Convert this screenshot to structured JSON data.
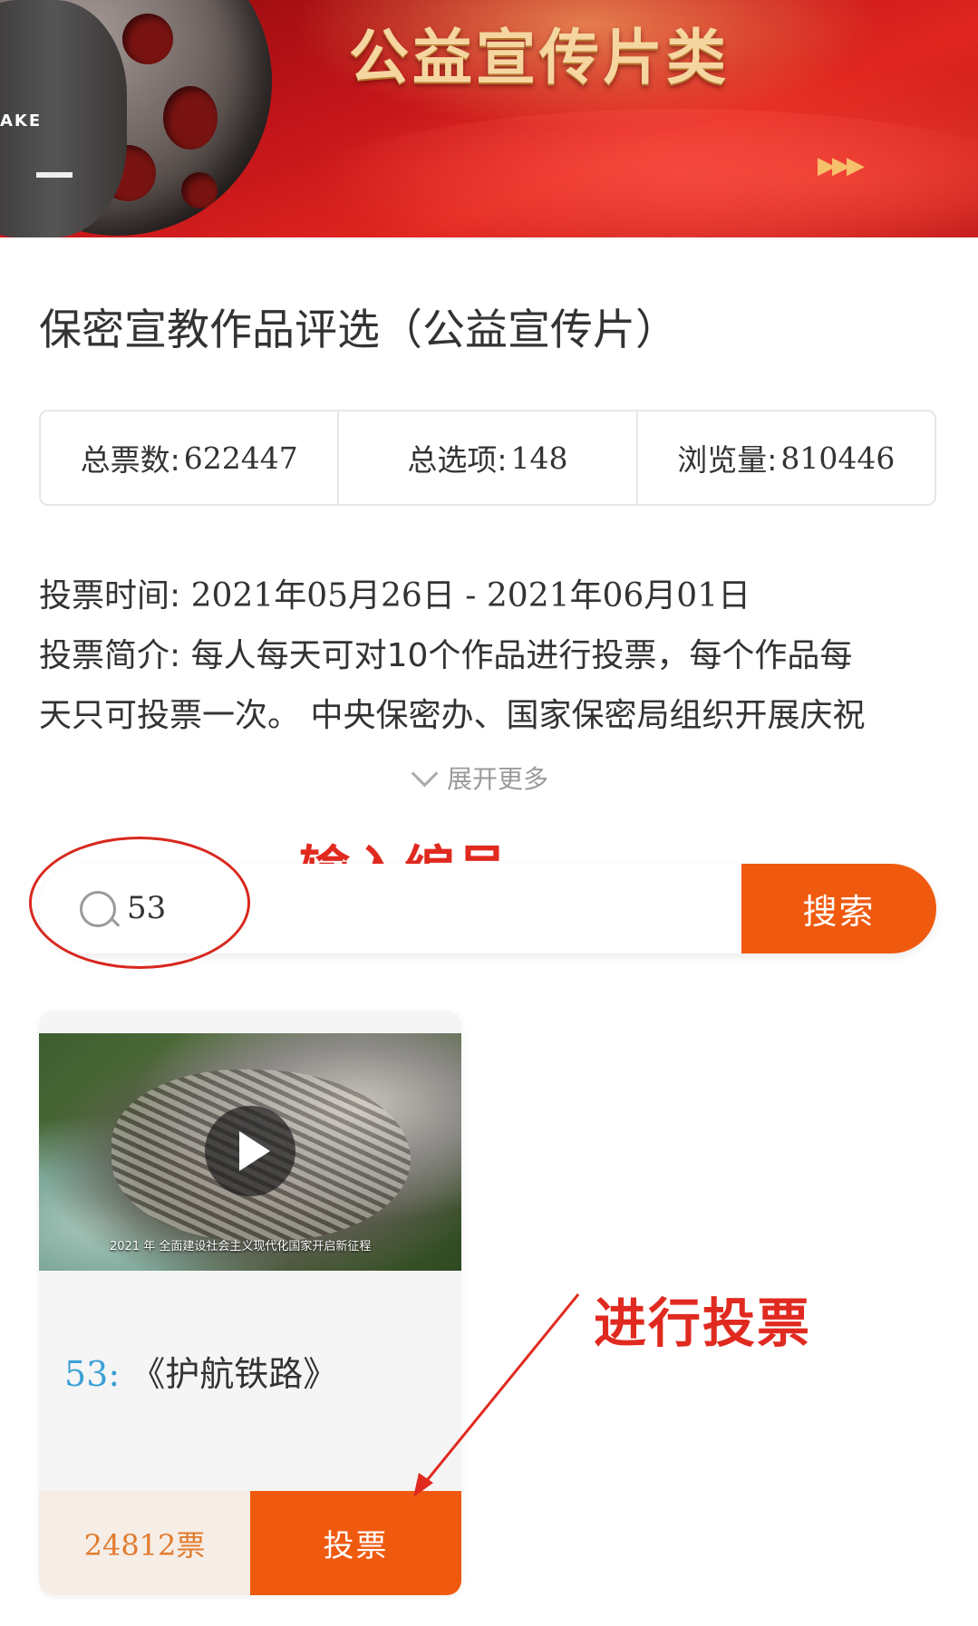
{
  "banner": {
    "title": "公益宣传片类",
    "reel_text": "AKE",
    "arrows": "▶▶▶"
  },
  "page_title": "保密宣教作品评选（公益宣传片）",
  "stats": [
    {
      "label": "总票数:",
      "value": "622447"
    },
    {
      "label": "总选项:",
      "value": "148"
    },
    {
      "label": "浏览量:",
      "value": "810446"
    }
  ],
  "vote_time": {
    "label": "投票时间:",
    "value": "2021年05月26日 - 2021年06月01日"
  },
  "vote_intro": {
    "label": "投票简介:",
    "line1": "每人每天可对10个作品进行投票，每个作品每",
    "line2": "天只可投票一次。 中央保密办、国家保密局组织开展庆祝"
  },
  "expand_label": "展开更多",
  "search": {
    "value": "53",
    "button_label": "搜索"
  },
  "annotations": {
    "input_hint": "输入编号",
    "vote_hint": "进行投票"
  },
  "card": {
    "thumb_caption": "2021 年 全面建设社会主义现代化国家开启新征程",
    "number": "53:",
    "title": "《护航铁路》",
    "votes": "24812票",
    "vote_button": "投票"
  },
  "colors": {
    "accent": "#f05a0f",
    "annotation": "#e02a20",
    "link_blue": "#3ba0d6",
    "votes_text": "#e27b2e"
  }
}
